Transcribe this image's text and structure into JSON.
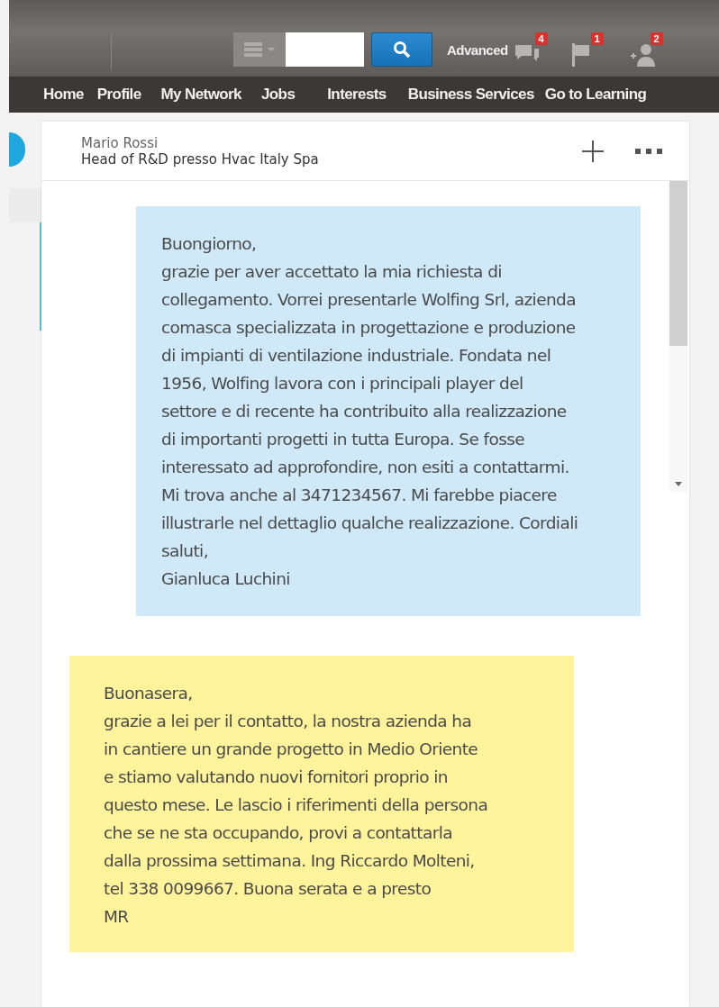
{
  "header": {
    "advanced_link": "Advanced",
    "notifications": [
      {
        "kind": "messages",
        "count": "4"
      },
      {
        "kind": "flag",
        "count": "1"
      },
      {
        "kind": "connections",
        "count": "2"
      }
    ]
  },
  "nav": [
    "Home",
    "Profile",
    "My Network",
    "Jobs",
    "Interests",
    "Business Services",
    "Go to Learning"
  ],
  "conversation": {
    "name": "Mario Rossi",
    "headline": "Head of R&D presso Hvac Italy Spa",
    "messages": [
      {
        "kind": "sent",
        "text": "Buongiorno,\ngrazie per aver accettato la mia richiesta di\ncollegamento. Vorrei presentarle Wolfing Srl, azienda\ncomasca specializzata in progettazione e produzione\ndi impianti di ventilazione industriale. Fondata nel\n1956, Wolfing lavora con i principali player del\nsettore e di recente ha contribuito alla realizzazione\ndi importanti progetti in tutta Europa. Se fosse\ninteressato ad approfondire, non esiti a contattarmi.\nMi trova anche al 3471234567. Mi farebbe piacere\nillustrarle nel dettaglio qualche realizzazione. Cordiali\nsaluti,\nGianluca Luchini"
      },
      {
        "kind": "received",
        "text": "Buonasera,\ngrazie a lei per il contatto, la nostra azienda ha\nin cantiere un grande progetto in Medio Oriente\ne stiamo valutando nuovi fornitori proprio in\nquesto mese. Le lascio i riferimenti della persona\nche se ne sta occupando, provi a contattarla\ndalla prossima settimana. Ing Riccardo Molteni,\ntel 338 0099667. Buona serata e a presto\nMR"
      }
    ]
  }
}
